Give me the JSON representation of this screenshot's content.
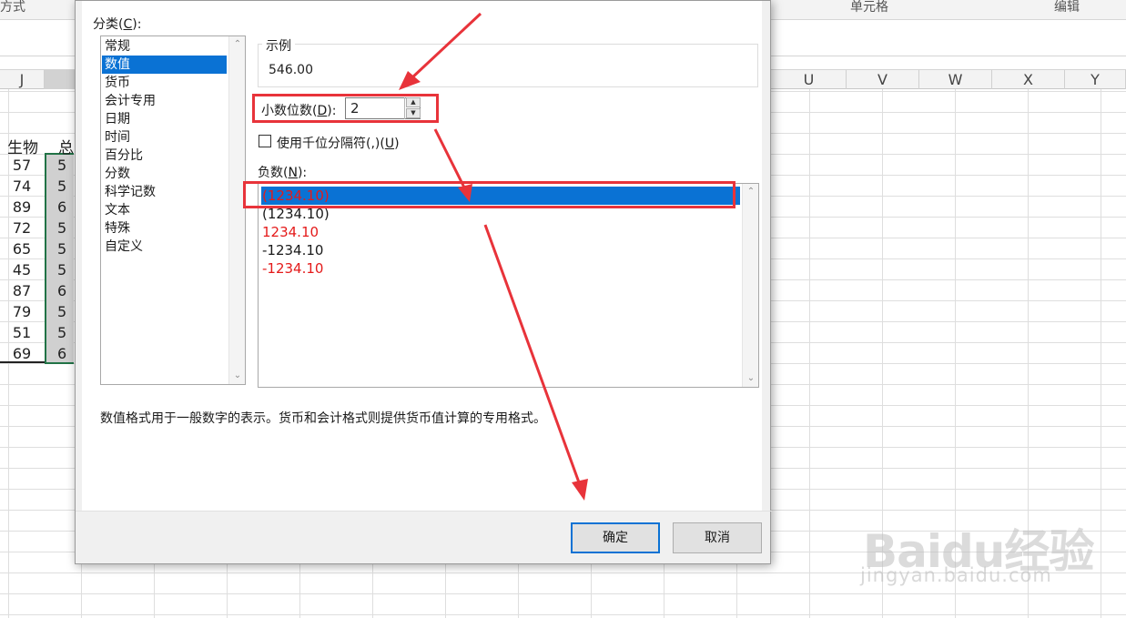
{
  "ribbon": {
    "group_alignment": "方式",
    "group_cells": "单元格",
    "group_edit": "编辑"
  },
  "columns": {
    "left": [
      "J"
    ],
    "right": [
      "U",
      "V",
      "W",
      "X",
      "Y"
    ]
  },
  "sheet": {
    "header_biology": "生物",
    "header_total": "总",
    "biology_values": [
      "57",
      "74",
      "89",
      "72",
      "65",
      "45",
      "87",
      "79",
      "51",
      "69"
    ],
    "total_partial": [
      "5",
      "5",
      "6",
      "5",
      "5",
      "5",
      "6",
      "5",
      "5",
      "6"
    ]
  },
  "dialog": {
    "category_label": "分类",
    "category_hotkey": "C",
    "categories": [
      "常规",
      "数值",
      "货币",
      "会计专用",
      "日期",
      "时间",
      "百分比",
      "分数",
      "科学记数",
      "文本",
      "特殊",
      "自定义"
    ],
    "selected_category": "数值",
    "sample_label": "示例",
    "sample_value": "546.00",
    "decimal_label": "小数位数",
    "decimal_hotkey": "D",
    "decimal_value": "2",
    "thousands_label": "使用千位分隔符(,)",
    "thousands_hotkey": "U",
    "thousands_checked": false,
    "negative_label": "负数",
    "negative_hotkey": "N",
    "negative_options": [
      {
        "text": "(1234.10)",
        "color": "#e41a1a",
        "selected": true
      },
      {
        "text": "(1234.10)",
        "color": "#1a1a1a",
        "selected": false
      },
      {
        "text": "1234.10",
        "color": "#e41a1a",
        "selected": false
      },
      {
        "text": "-1234.10",
        "color": "#1a1a1a",
        "selected": false
      },
      {
        "text": "-1234.10",
        "color": "#e41a1a",
        "selected": false
      }
    ],
    "description": "数值格式用于一般数字的表示。货币和会计格式则提供货币值计算的专用格式。",
    "ok_button": "确定",
    "cancel_button": "取消"
  },
  "colors": {
    "selection_blue": "#0a72d4",
    "annotation_red": "#e8333a",
    "negative_red": "#e41a1a",
    "excel_green": "#217346"
  },
  "watermark": {
    "logo": "Baidu经验",
    "url": "jingyan.baidu.com"
  }
}
